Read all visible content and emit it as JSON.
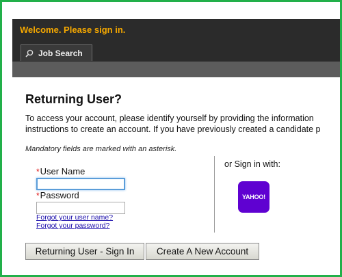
{
  "header": {
    "welcome": "Welcome. Please sign in.",
    "tab": {
      "label": "Job Search",
      "icon": "search-icon"
    }
  },
  "login": {
    "title": "Returning User?",
    "intro_line1": "To access your account, please identify yourself by providing the information",
    "intro_line2": "instructions to create an account. If you have previously created a candidate p",
    "mandatory_note": "Mandatory fields are marked with an asterisk.",
    "required_marker": "*",
    "username_label": "User Name",
    "username_value": "",
    "password_label": "Password",
    "password_value": "",
    "forgot_username": "Forgot your user name?",
    "forgot_password": "Forgot your password?"
  },
  "social": {
    "label": "or Sign in with:",
    "provider": "YAHOO!",
    "provider_color": "#5f01d1"
  },
  "actions": {
    "sign_in": "Returning User - Sign In",
    "create_account": "Create A New Account"
  },
  "colors": {
    "frame_border": "#22b04a",
    "welcome_text": "#f5a800",
    "header_bg": "#2b2b2b"
  }
}
